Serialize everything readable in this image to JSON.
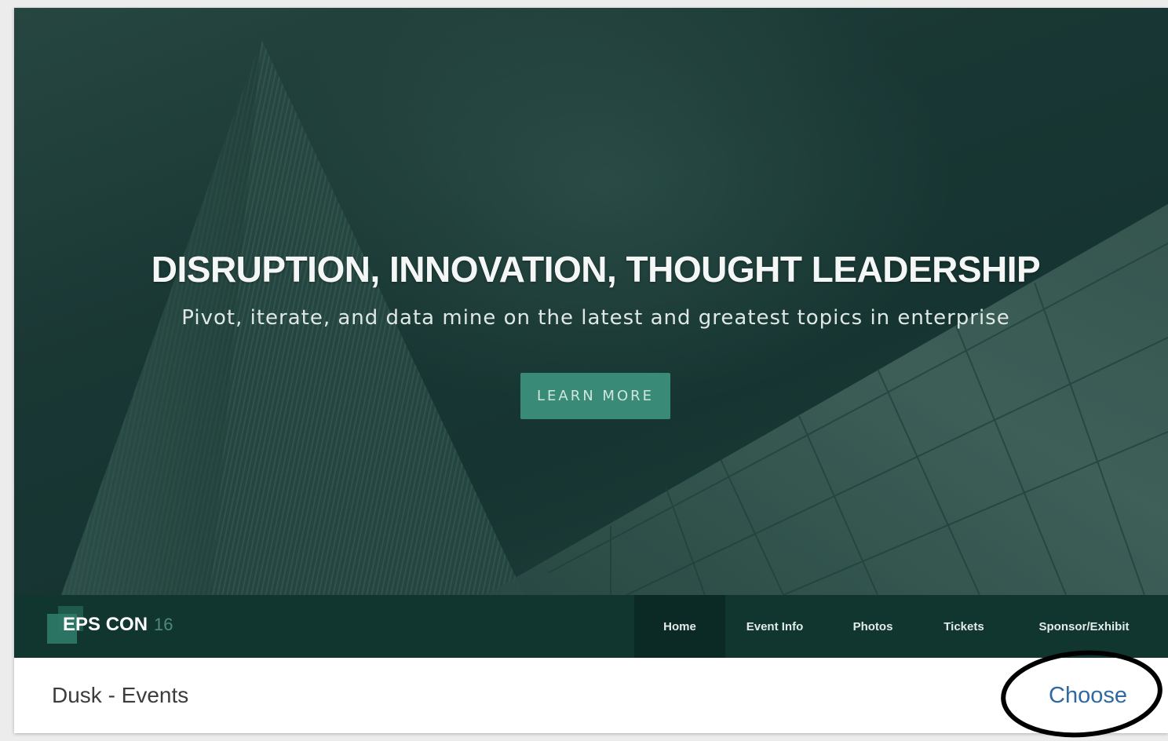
{
  "template_card": {
    "preview": {
      "hero": {
        "title": "DISRUPTION, INNOVATION, THOUGHT LEADERSHIP",
        "subtitle": "Pivot, iterate, and data mine on the latest and greatest topics in enterprise",
        "cta_label": "LEARN MORE"
      },
      "nav": {
        "logo_text": "EPS CON",
        "logo_suffix": "16",
        "items": [
          {
            "label": "Home",
            "active": true
          },
          {
            "label": "Event Info",
            "active": false
          },
          {
            "label": "Photos",
            "active": false
          },
          {
            "label": "Tickets",
            "active": false
          },
          {
            "label": "Sponsor/Exhibit",
            "active": false
          }
        ]
      }
    },
    "footer": {
      "template_name": "Dusk - Events",
      "choose_label": "Choose"
    }
  },
  "colors": {
    "hero_overlay": "#1a3a35",
    "nav_background": "#11352f",
    "nav_active": "#0c2a25",
    "cta_background": "#3a8a78",
    "link": "#2e6aa1"
  }
}
